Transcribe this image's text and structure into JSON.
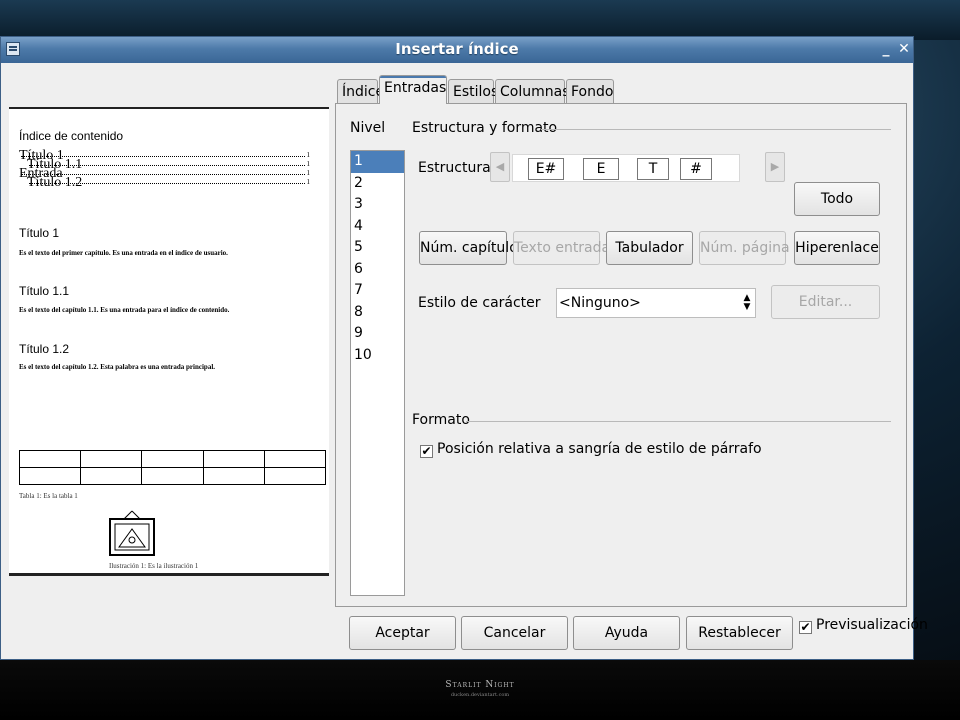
{
  "window": {
    "title": "Insertar índice"
  },
  "tabs": [
    {
      "label": "Índice"
    },
    {
      "label": "Entradas"
    },
    {
      "label": "Estilos"
    },
    {
      "label": "Columnas"
    },
    {
      "label": "Fondo"
    }
  ],
  "level": {
    "label": "Nivel",
    "items": [
      "1",
      "2",
      "3",
      "4",
      "5",
      "6",
      "7",
      "8",
      "9",
      "10"
    ],
    "selected": "1"
  },
  "structure": {
    "section_label": "Estructura y formato",
    "label": "Estructura",
    "tokens": [
      "E#",
      "E",
      "T",
      "#"
    ],
    "all_button": "Todo"
  },
  "insert_buttons": {
    "chapter_number": "Núm. capítulo",
    "entry_text": "Texto entrada",
    "tab_stop": "Tabulador",
    "page_number": "Núm. página",
    "hyperlink": "Hiperenlace"
  },
  "char_style": {
    "label": "Estilo de carácter",
    "value": "<Ninguno>",
    "edit_button": "Editar..."
  },
  "format": {
    "section_label": "Formato",
    "relative_indent_label": "Posición relativa a sangría de estilo de párrafo",
    "relative_indent_checked": true
  },
  "footer": {
    "ok": "Aceptar",
    "cancel": "Cancelar",
    "help": "Ayuda",
    "reset": "Restablecer",
    "preview_label": "Previsualización",
    "preview_checked": true
  },
  "preview": {
    "heading": "Índice de contenido",
    "toc": [
      {
        "label": "Título 1",
        "page": "1"
      },
      {
        "label": "Título 1.1",
        "page": "1"
      },
      {
        "label": "Entrada",
        "page": "1"
      },
      {
        "label": "Título 1.2",
        "page": "1"
      }
    ],
    "sections": [
      {
        "title": "Título 1",
        "text": "Es el texto del primer capítulo. Es una entrada en el índice de usuario."
      },
      {
        "title": "Título 1.1",
        "text": "Es el texto del capítulo 1.1. Es una entrada para el índice de contenido."
      },
      {
        "title": "Título 1.2",
        "text": "Es el texto del capítulo 1.2. Esta palabra es una entrada principal."
      }
    ],
    "table_caption": "Tabla 1: Es la tabla 1",
    "illustration_caption": "Ilustración 1: Es la ilustración 1"
  },
  "wallpaper": {
    "brand": "Starlit Night",
    "credit": "ducken.deviantart.com"
  }
}
